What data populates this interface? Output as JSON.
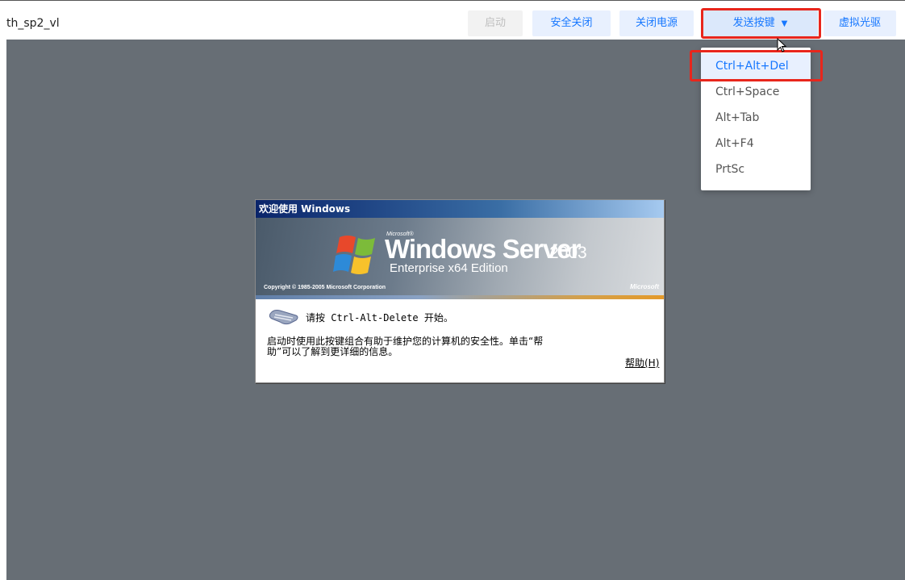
{
  "toolbar": {
    "vm_name": "th_sp2_vl",
    "buttons": {
      "start": "启动",
      "safe_shutdown": "安全关闭",
      "power_off": "关闭电源",
      "send_keys": "发送按键",
      "virtual_cdrom": "虚拟光驱"
    }
  },
  "send_keys_menu": {
    "items": [
      "Ctrl+Alt+Del",
      "Ctrl+Space",
      "Alt+Tab",
      "Alt+F4",
      "PrtSc"
    ],
    "highlighted": "Ctrl+Alt+Del"
  },
  "windows_dialog": {
    "title": "欢迎使用 Windows",
    "banner": {
      "microsoft_small": "Microsoft®",
      "windows": "Windows Server",
      "version": "2003",
      "edition": "Enterprise x64 Edition",
      "copyright": "Copyright © 1985-2005 Microsoft Corporation",
      "ms_logo": "Microsoft"
    },
    "press_instruction": "请按 Ctrl-Alt-Delete 开始。",
    "help_text": "启动时使用此按键组合有助于维护您的计算机的安全性。单击“帮助”可以了解到更详细的信息。",
    "help_link": "帮助(H)"
  },
  "colors": {
    "accent": "#1677ff",
    "highlight_box": "#e8261c",
    "console_bg": "#676e75"
  }
}
